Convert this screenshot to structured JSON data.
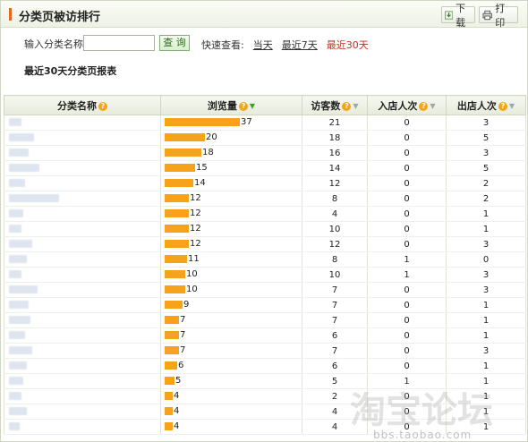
{
  "header": {
    "title": "分类页被访排行",
    "download_label": "下载",
    "print_label": "打印"
  },
  "search": {
    "label": "输入分类名称:",
    "value": "",
    "placeholder": "",
    "button_label": "查 询"
  },
  "quick": {
    "label": "快速查看:",
    "options": [
      "当天",
      "最近7天",
      "最近30天"
    ],
    "active": "最近30天"
  },
  "report_title": "最近30天分类页报表",
  "table": {
    "columns": [
      "分类名称",
      "浏览量",
      "访客数",
      "入店人次",
      "出店人次"
    ],
    "rows": [
      {
        "views": 37,
        "visitors": 21,
        "enter": 0,
        "exit": 3
      },
      {
        "views": 20,
        "visitors": 18,
        "enter": 0,
        "exit": 5
      },
      {
        "views": 18,
        "visitors": 16,
        "enter": 0,
        "exit": 3
      },
      {
        "views": 15,
        "visitors": 14,
        "enter": 0,
        "exit": 5
      },
      {
        "views": 14,
        "visitors": 12,
        "enter": 0,
        "exit": 2
      },
      {
        "views": 12,
        "visitors": 8,
        "enter": 0,
        "exit": 2
      },
      {
        "views": 12,
        "visitors": 4,
        "enter": 0,
        "exit": 1
      },
      {
        "views": 12,
        "visitors": 10,
        "enter": 0,
        "exit": 1
      },
      {
        "views": 12,
        "visitors": 12,
        "enter": 0,
        "exit": 3
      },
      {
        "views": 11,
        "visitors": 8,
        "enter": 1,
        "exit": 0
      },
      {
        "views": 10,
        "visitors": 10,
        "enter": 1,
        "exit": 3
      },
      {
        "views": 10,
        "visitors": 7,
        "enter": 0,
        "exit": 3
      },
      {
        "views": 9,
        "visitors": 7,
        "enter": 0,
        "exit": 1
      },
      {
        "views": 7,
        "visitors": 7,
        "enter": 0,
        "exit": 1
      },
      {
        "views": 7,
        "visitors": 6,
        "enter": 0,
        "exit": 1
      },
      {
        "views": 7,
        "visitors": 7,
        "enter": 0,
        "exit": 3
      },
      {
        "views": 6,
        "visitors": 6,
        "enter": 0,
        "exit": 1
      },
      {
        "views": 5,
        "visitors": 5,
        "enter": 1,
        "exit": 1
      },
      {
        "views": 4,
        "visitors": 2,
        "enter": 0,
        "exit": 1
      },
      {
        "views": 4,
        "visitors": 4,
        "enter": 0,
        "exit": 1
      },
      {
        "views": 4,
        "visitors": 4,
        "enter": 0,
        "exit": 1
      }
    ]
  },
  "watermark": {
    "text": "淘宝论坛",
    "url": "bbs.taobao.com"
  },
  "colors": {
    "bar": "#f7a21b",
    "accent": "#e8651f",
    "active_link": "#c0301c",
    "header_bg": "#eef2e5"
  }
}
